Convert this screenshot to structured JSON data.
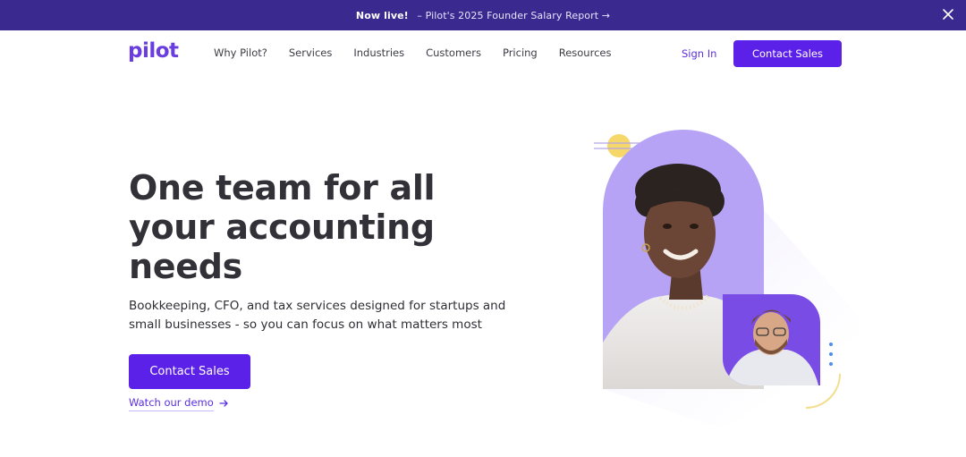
{
  "announcement": {
    "bold": "Now live!",
    "link": "– Pilot's 2025 Founder Salary Report →",
    "close_icon": "close-icon"
  },
  "nav": {
    "logo": "pilot",
    "links": [
      "Why Pilot?",
      "Services",
      "Industries",
      "Customers",
      "Pricing",
      "Resources"
    ],
    "sign_in": "Sign In",
    "cta": "Contact Sales"
  },
  "hero": {
    "title_lines": [
      "One team for all",
      "your accounting",
      "needs"
    ],
    "subtitle_lines": [
      "Bookkeeping, CFO, and tax services designed for startups and",
      "small businesses - so you can focus on what matters most"
    ],
    "cta": "Contact Sales",
    "demo_link": "Watch our demo"
  },
  "colors": {
    "brand": "#5b21e8",
    "announce_bg": "#3a2a8f",
    "lavender": "#b8a6f5",
    "purple_card": "#7b4fe6",
    "accent_yellow": "#f5d76e"
  }
}
